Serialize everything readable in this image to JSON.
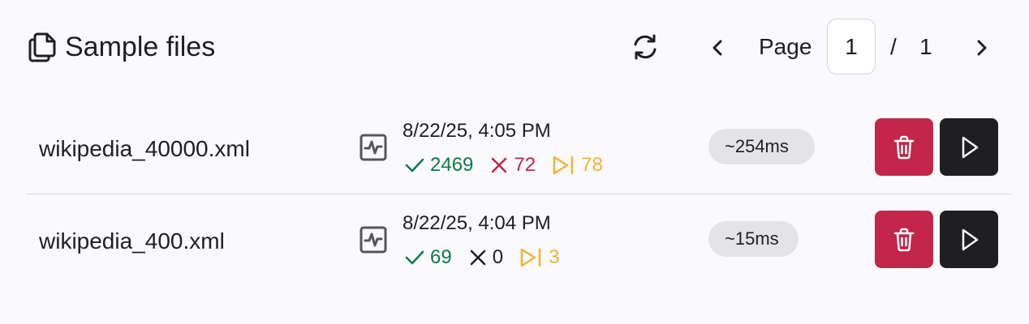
{
  "header": {
    "title": "Sample files",
    "title_icon": "copy-icon",
    "refresh_icon": "refresh-icon",
    "prev_icon": "chevron-left-icon",
    "next_icon": "chevron-right-icon"
  },
  "pagination": {
    "page_label": "Page",
    "current_page": "1",
    "separator": "/",
    "total_pages": "1"
  },
  "files": [
    {
      "name": "wikipedia_40000.xml",
      "date": "8/22/25, 4:05 PM",
      "passed": "2469",
      "failed": "72",
      "skipped": "78",
      "duration": "~254ms"
    },
    {
      "name": "wikipedia_400.xml",
      "date": "8/22/25, 4:04 PM",
      "passed": "69",
      "failed": "0",
      "skipped": "3",
      "duration": "~15ms"
    }
  ],
  "colors": {
    "pass": "#0c7a4a",
    "fail": "#c32447",
    "neutral": "#1f1f23",
    "skip": "#f2b233",
    "delete_button": "#c3264a",
    "run_button": "#1f1f23",
    "duration_badge": "#e4e3e8"
  }
}
